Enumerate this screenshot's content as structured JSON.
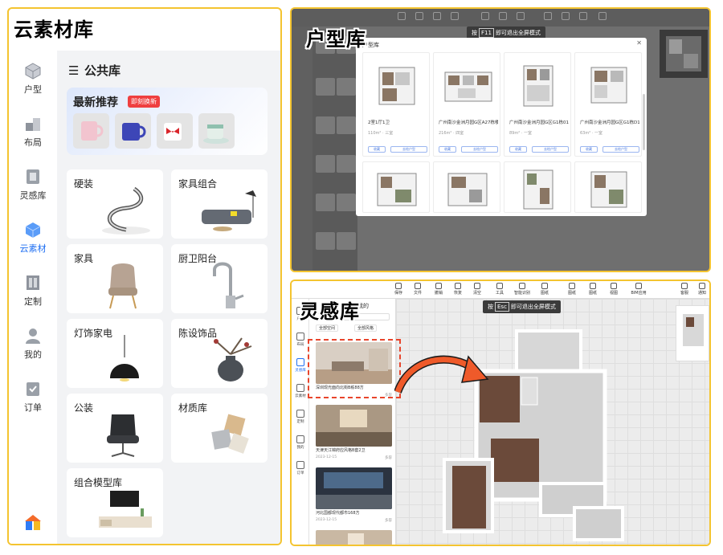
{
  "left_panel": {
    "title": "云素材库",
    "nav": [
      {
        "label": "户型",
        "icon": "cube-icon"
      },
      {
        "label": "布局",
        "icon": "layout-blocks-icon"
      },
      {
        "label": "灵感库",
        "icon": "inspiration-book-icon"
      },
      {
        "label": "云素材",
        "icon": "cloud-material-icon",
        "active": true
      },
      {
        "label": "定制",
        "icon": "custom-cabinet-icon"
      },
      {
        "label": "我的",
        "icon": "user-icon"
      },
      {
        "label": "订单",
        "icon": "order-check-icon"
      }
    ],
    "library_title": "公共库",
    "recommend": {
      "title": "最新推荐",
      "badge": "即刻换新"
    },
    "categories": [
      {
        "label": "硬装",
        "icon": "spiral-staircase-icon"
      },
      {
        "label": "家具组合",
        "icon": "sofa-lamp-icon"
      },
      {
        "label": "家具",
        "icon": "armchair-icon"
      },
      {
        "label": "厨卫阳台",
        "icon": "faucet-icon"
      },
      {
        "label": "灯饰家电",
        "icon": "pendant-lamp-icon"
      },
      {
        "label": "陈设饰品",
        "icon": "vase-decor-icon"
      },
      {
        "label": "公装",
        "icon": "office-chair-icon"
      },
      {
        "label": "材质库",
        "icon": "material-cubes-icon"
      },
      {
        "label": "组合模型库",
        "icon": "tv-cabinet-icon"
      }
    ],
    "brand_icon": "brand-house-logo-icon"
  },
  "top_right_panel": {
    "title": "户型库",
    "esc_hint": {
      "prefix": "按",
      "key": "F11",
      "text": "即可退出全屏模式"
    },
    "modal_title": "户型库",
    "cards": [
      {
        "name": "2室1厅1卫",
        "meta1": "面积",
        "meta2": "户型",
        "val1": "110m²",
        "val2": "三室",
        "btn1": "收藏",
        "btn2": "去绘户型"
      },
      {
        "name": "广州南沙金洲月园G区A27栋楼…",
        "meta1": "面积",
        "meta2": "户型",
        "val1": "216m²",
        "val2": "四室",
        "btn1": "收藏",
        "btn2": "去绘户型"
      },
      {
        "name": "广州南沙金洲月园G区G1栋01户…",
        "meta1": "面积",
        "meta2": "户型",
        "val1": "89m²",
        "val2": "一室",
        "btn1": "收藏",
        "btn2": "去绘户型"
      },
      {
        "name": "广州南沙金洲月园G区G1栋D1…",
        "meta1": "面积",
        "meta2": "户型",
        "val1": "63m²",
        "val2": "一室",
        "btn1": "收藏",
        "btn2": "去绘户型"
      }
    ]
  },
  "bottom_right_panel": {
    "title": "灵感库",
    "esc_hint": {
      "prefix": "按",
      "key": "Esc",
      "text": "即可退出全屏模式"
    },
    "toolbar": [
      "保存",
      "文件",
      "撤销",
      "恢复",
      "清空",
      "工具",
      "智能识别",
      "图纸",
      "图纸",
      "图纸",
      "视图",
      "BIM应用",
      "客服",
      "通知"
    ],
    "rail": [
      "户型",
      "布局",
      "灵感库",
      "云素材",
      "定制",
      "我的",
      "订单"
    ],
    "tabs": [
      "灵感",
      "我的"
    ],
    "search_placeholder": "搜索灵感",
    "filters": [
      "全部空间",
      "全部风格"
    ],
    "items": [
      {
        "name": "深圳现光面向北街B栋88方",
        "date": "",
        "user": "多容"
      },
      {
        "name": "天津天江锦府应风格B套2卫",
        "date": "2023-12-15",
        "user": "多容"
      },
      {
        "name": "河北国都现代都市168方",
        "date": "2023-12-15",
        "user": "多容"
      }
    ]
  }
}
